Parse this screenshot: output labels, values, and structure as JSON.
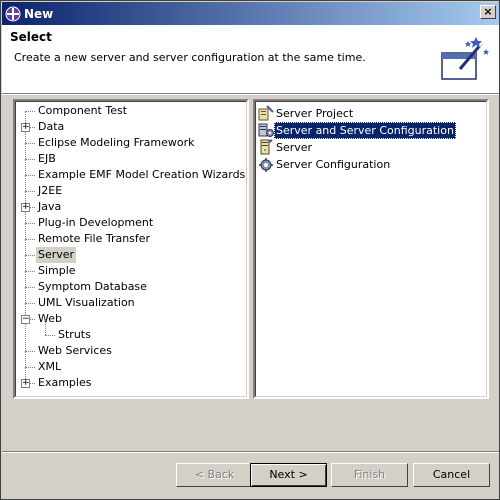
{
  "window": {
    "title": "New",
    "close_glyph": "×"
  },
  "banner": {
    "title": "Select",
    "description": "Create a new server and server configuration at the same time.",
    "icon": "wizard-wand-icon"
  },
  "tree": {
    "items": [
      {
        "label": "Component Test",
        "expander": null
      },
      {
        "label": "Data",
        "expander": "+"
      },
      {
        "label": "Eclipse Modeling Framework",
        "expander": null
      },
      {
        "label": "EJB",
        "expander": null
      },
      {
        "label": "Example EMF Model Creation Wizards",
        "expander": null
      },
      {
        "label": "J2EE",
        "expander": null
      },
      {
        "label": "Java",
        "expander": "+"
      },
      {
        "label": "Plug-in Development",
        "expander": null
      },
      {
        "label": "Remote File Transfer",
        "expander": null
      },
      {
        "label": "Server",
        "expander": null,
        "selected": true
      },
      {
        "label": "Simple",
        "expander": null
      },
      {
        "label": "Symptom Database",
        "expander": null
      },
      {
        "label": "UML Visualization",
        "expander": null
      },
      {
        "label": "Web",
        "expander": "−"
      },
      {
        "label": "Struts",
        "expander": null,
        "child": true
      },
      {
        "label": "Web Services",
        "expander": null
      },
      {
        "label": "XML",
        "expander": null
      },
      {
        "label": "Examples",
        "expander": "+"
      }
    ]
  },
  "list": {
    "items": [
      {
        "label": "Server Project",
        "icon": "server-project-icon"
      },
      {
        "label": "Server and Server Configuration",
        "icon": "server-and-config-icon",
        "selected": true
      },
      {
        "label": "Server",
        "icon": "server-icon"
      },
      {
        "label": "Server Configuration",
        "icon": "server-configuration-icon"
      }
    ]
  },
  "buttons": {
    "back": "< Back",
    "next": "Next >",
    "finish": "Finish",
    "cancel": "Cancel"
  }
}
